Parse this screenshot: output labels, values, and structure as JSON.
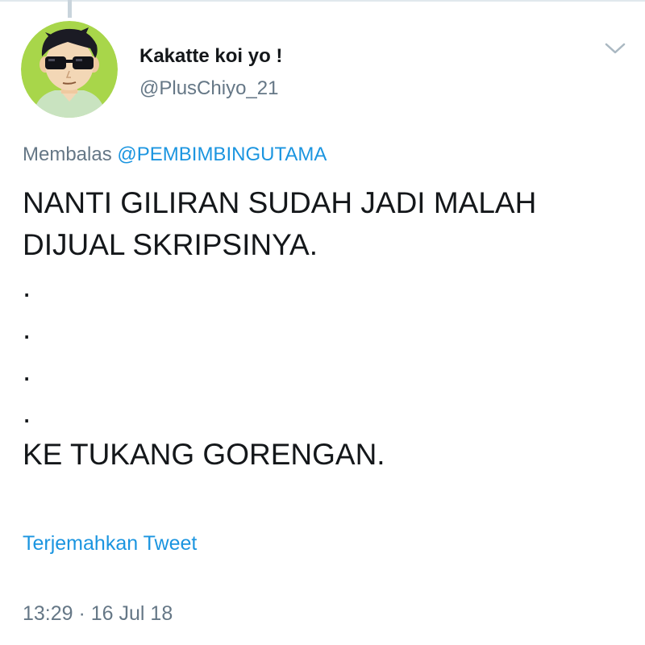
{
  "author": {
    "display_name": "Kakatte koi yo !",
    "handle": "@PlusChiyo_21"
  },
  "reply": {
    "prefix": "Membalas",
    "mention": "@PEMBIMBINGUTAMA"
  },
  "tweet": {
    "lines": [
      "NANTI GILIRAN SUDAH JADI MALAH",
      "DIJUAL SKRIPSINYA.",
      ".",
      ".",
      ".",
      ".",
      "KE TUKANG GORENGAN."
    ]
  },
  "actions": {
    "translate_label": "Terjemahkan Tweet"
  },
  "meta": {
    "timestamp": "13:29 · 16 Jul 18"
  },
  "icons": {
    "menu": "chevron-down-icon",
    "avatar": "avatar-sunglasses"
  },
  "colors": {
    "link": "#1b95e0",
    "secondary_text": "#657786",
    "primary_text": "#14171a"
  }
}
